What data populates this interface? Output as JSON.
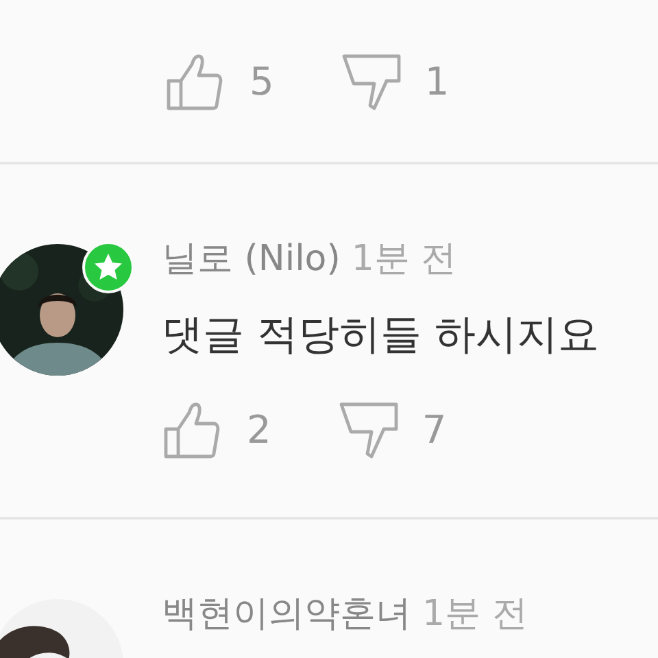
{
  "comments": [
    {
      "votes": {
        "likes": "5",
        "dislikes": "1"
      }
    },
    {
      "author": "닐로 (Nilo)",
      "time": "1분 전",
      "text": "댓글 적당히들 하시지요",
      "badge": true,
      "votes": {
        "likes": "2",
        "dislikes": "7"
      }
    },
    {
      "author": "백현이의약혼녀",
      "time": "1분 전"
    }
  ]
}
